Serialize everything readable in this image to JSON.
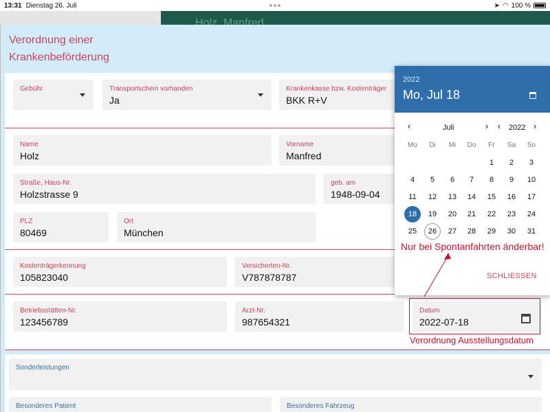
{
  "status": {
    "time": "13:31",
    "date": "Dienstag 26. Juli",
    "battery": "100 %"
  },
  "header_ghost": "Holz, Manfred",
  "dialog": {
    "title_line1": "Verordnung einer",
    "title_line2": "Krankenbeförderung"
  },
  "fields": {
    "gebuehr": {
      "label": "Gebühr",
      "value": ""
    },
    "transportschein": {
      "label": "Transportschein vorhanden",
      "value": "Ja"
    },
    "krankenkasse": {
      "label": "Krankenkasse bzw. Kostenträger",
      "value": "BKK R+V"
    },
    "name": {
      "label": "Name",
      "value": "Holz"
    },
    "vorname": {
      "label": "Vorname",
      "value": "Manfred"
    },
    "strasse": {
      "label": "Straße, Haus-Nr.",
      "value": "Holzstrasse 9"
    },
    "geb": {
      "label": "geb. am",
      "value": "1948-09-04"
    },
    "plz": {
      "label": "PLZ",
      "value": "80469"
    },
    "ort": {
      "label": "Ort",
      "value": "München"
    },
    "kostentraeger": {
      "label": "Kostenträgerkennung",
      "value": "105823040"
    },
    "versicherten": {
      "label": "Versicherten-Nr.",
      "value": "V787878787"
    },
    "betriebsstaette": {
      "label": "Betriebsstätten-Nr.",
      "value": "123456789"
    },
    "arzt": {
      "label": "Arzt-Nr.",
      "value": "987654321"
    },
    "datum": {
      "label": "Datum",
      "value": "2022-07-18"
    },
    "sonderleistungen": {
      "label": "Sonderleistungen",
      "value": ""
    },
    "patient": {
      "label": "Besonderes Patient",
      "value": ""
    },
    "fahrzeug": {
      "label": "Besonderes Fahrzeug",
      "value": ""
    }
  },
  "datepicker": {
    "year": "2022",
    "selected_label": "Mo, Jul 18",
    "month": "Juli",
    "nav_year": "2022",
    "weekdays": [
      "Mo",
      "Di",
      "Mi",
      "Do",
      "Fr",
      "Sa",
      "So"
    ],
    "weeks": [
      [
        "",
        "",
        "",
        "",
        "1",
        "2",
        "3"
      ],
      [
        "4",
        "5",
        "6",
        "7",
        "8",
        "9",
        "10"
      ],
      [
        "11",
        "12",
        "13",
        "14",
        "15",
        "16",
        "17"
      ],
      [
        "18",
        "19",
        "20",
        "21",
        "22",
        "23",
        "24"
      ],
      [
        "25",
        "26",
        "27",
        "28",
        "29",
        "30",
        "31"
      ]
    ],
    "selected_day": "18",
    "today_day": "26",
    "close_label": "SCHLIESSEN"
  },
  "annotations": {
    "spontan": "Nur bei Spontanfahrten änderbar!",
    "ausstellung": "Verordnung Ausstellungsdatum"
  },
  "colors": {
    "accent": "#c8455a",
    "picker_header": "#2f6eab",
    "annotation": "#c8102e",
    "dialog_bg": "#d3ecf9"
  }
}
